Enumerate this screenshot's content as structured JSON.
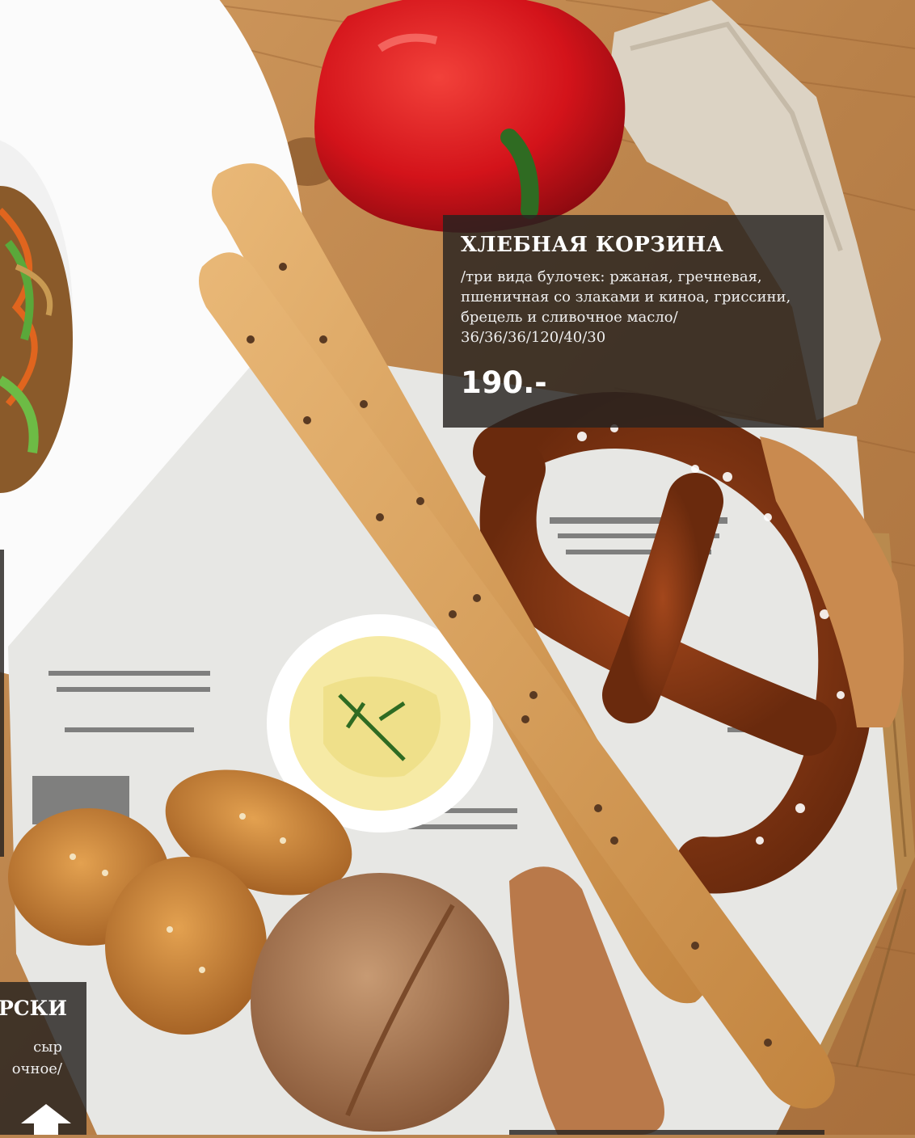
{
  "main_card": {
    "title": "ХЛЕБНАЯ КОРЗИНА",
    "description_lines": [
      "/три вида булочек: ржаная, гречневая,",
      "пшеничная со злаками и киноа, гриссини,",
      "брецель и сливочное масло/",
      "36/36/36/120/40/30"
    ],
    "price": "190.-"
  },
  "left_card": {
    "title_fragment": "АРСКИ",
    "desc_fragments": [
      "сыр",
      "очное/"
    ]
  },
  "scroll_up_button": {
    "icon": "arrow-up-icon"
  },
  "colors": {
    "panel": "#262220",
    "wood": "#b9844f",
    "pepper": "#d4141a",
    "plate": "#ffffff"
  }
}
